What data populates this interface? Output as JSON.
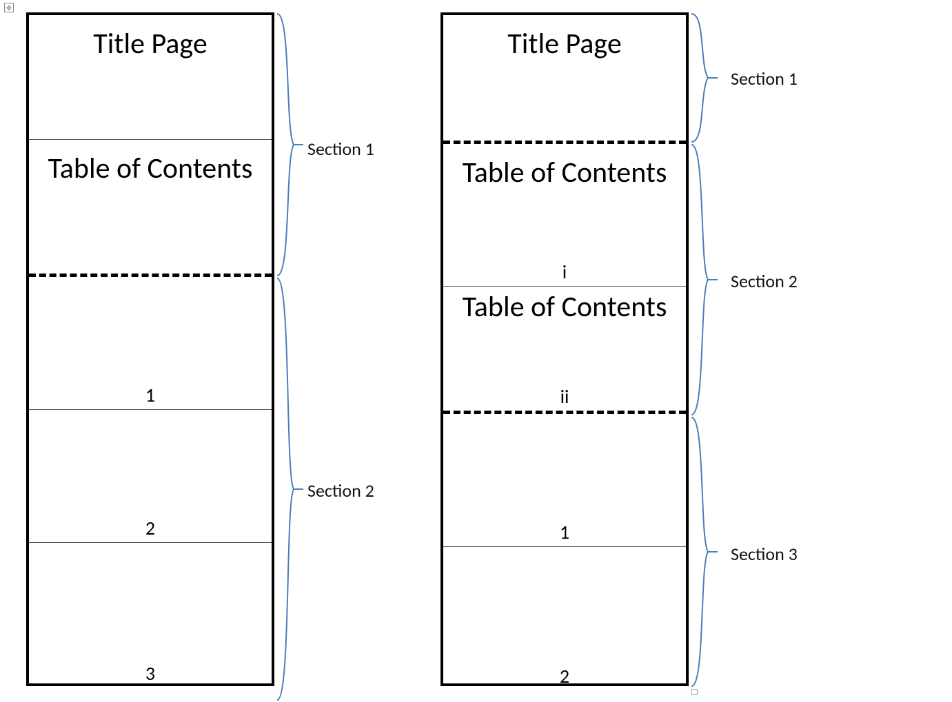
{
  "left": {
    "sections": [
      "Section 1",
      "Section 2"
    ],
    "pages": [
      {
        "title": "Title Page",
        "footer": ""
      },
      {
        "title": "Table of Contents",
        "footer": ""
      },
      {
        "title": "",
        "footer": "1"
      },
      {
        "title": "",
        "footer": "2"
      },
      {
        "title": "",
        "footer": "3"
      }
    ]
  },
  "right": {
    "sections": [
      "Section 1",
      "Section 2",
      "Section 3"
    ],
    "pages": [
      {
        "title": "Title Page",
        "footer": ""
      },
      {
        "title": "Table of Contents",
        "footer": "i"
      },
      {
        "title": "Table of Contents",
        "footer": "ii"
      },
      {
        "title": "",
        "footer": "1"
      },
      {
        "title": "",
        "footer": "2"
      }
    ]
  },
  "colors": {
    "brace": "#4A7EBB"
  }
}
